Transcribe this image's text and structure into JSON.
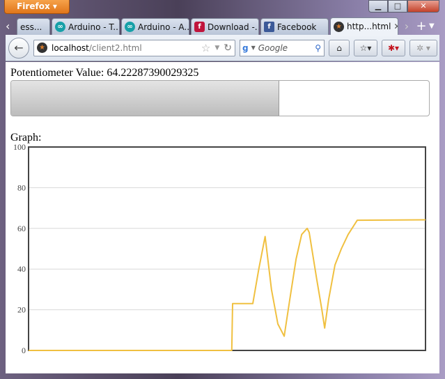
{
  "browser": {
    "menu_button": "Firefox",
    "url_host": "localhost",
    "url_path": "/client2.html",
    "search_placeholder": "Google"
  },
  "tabs": [
    {
      "label": "ess...",
      "icon": "generic"
    },
    {
      "label": "Arduino - T...",
      "icon": "arduino-icon"
    },
    {
      "label": "Arduino - A...",
      "icon": "arduino-icon"
    },
    {
      "label": "Download -...",
      "icon": "flipboard-icon"
    },
    {
      "label": "Facebook",
      "icon": "facebook-icon"
    },
    {
      "label": "http...html",
      "icon": "site-star-icon",
      "active": true
    }
  ],
  "page": {
    "potentiometer_label": "Potentiometer Value: ",
    "potentiometer_value": "64.22287390029325",
    "progress_percent": 64.22,
    "graph_label": "Graph:"
  },
  "chart_data": {
    "type": "line",
    "ylim": [
      0,
      100
    ],
    "xlim": [
      0,
      100
    ],
    "yticks": [
      "0",
      "20",
      "40",
      "60",
      "80",
      "100"
    ],
    "grid": "horizontal",
    "color": "#f0c040",
    "x": [
      0,
      51.2,
      51.4,
      56.5,
      58,
      59.6,
      61.2,
      62.8,
      64.4,
      65.8,
      67.4,
      68.8,
      70.2,
      70.7,
      72.6,
      73.9,
      74.6,
      75.6,
      77.2,
      78.8,
      80.5,
      82.8,
      100
    ],
    "y": [
      0,
      0,
      23,
      23,
      40,
      56,
      30,
      13,
      7,
      25,
      45,
      57,
      60,
      58,
      35,
      20,
      11,
      25,
      42,
      50,
      57,
      64,
      64.2
    ]
  }
}
